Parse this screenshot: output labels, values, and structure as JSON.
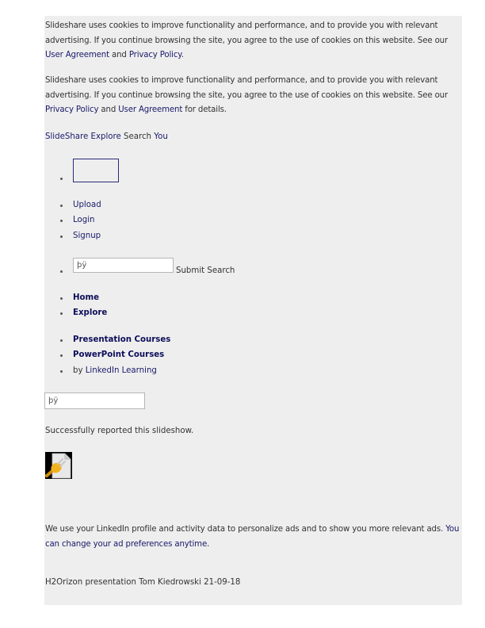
{
  "cookie_notice_1": {
    "text_before": "Slideshare uses cookies to improve functionality and performance, and to provide you with relevant advertising. If you continue browsing the site, you agree to the use of cookies on this website. See our ",
    "link1": "User Agreement",
    "middle": " and ",
    "link2": "Privacy Policy",
    "text_after": "."
  },
  "cookie_notice_2": {
    "text_before": "Slideshare uses cookies to improve functionality and performance, and to provide you with relevant advertising. If you continue browsing the site, you agree to the use of cookies on this website. See our ",
    "link1": "Privacy Policy",
    "middle": " and ",
    "link2": "User Agreement",
    "text_after": " for details."
  },
  "top_nav": {
    "brand": "SlideShare",
    "explore": "Explore",
    "search": "Search",
    "you": "You"
  },
  "account_menu": {
    "items": [
      "Upload",
      "Login",
      "Signup"
    ]
  },
  "search_form": {
    "value": "þÿ",
    "submit_label": "Submit Search"
  },
  "main_nav": {
    "items": [
      "Home",
      "Explore"
    ]
  },
  "courses": {
    "items": [
      "Presentation Courses",
      "PowerPoint Courses"
    ],
    "by_prefix": "by ",
    "by_link": "LinkedIn Learning"
  },
  "secondary_input": {
    "value": "þÿ"
  },
  "report_status": "Successfully reported this slideshow.",
  "plugin_icon": "missing-plugin-icon",
  "ads_notice": {
    "text": "We use your LinkedIn profile and activity data to personalize ads and to show you more relevant ads. ",
    "link": "You can change your ad preferences anytime."
  },
  "presentation_title": "H2Orizon presentation Tom Kiedrowski 21-09-18",
  "colors": {
    "panel_bg": "#eeeeee",
    "link": "#1a1a6b",
    "text": "#333333"
  }
}
